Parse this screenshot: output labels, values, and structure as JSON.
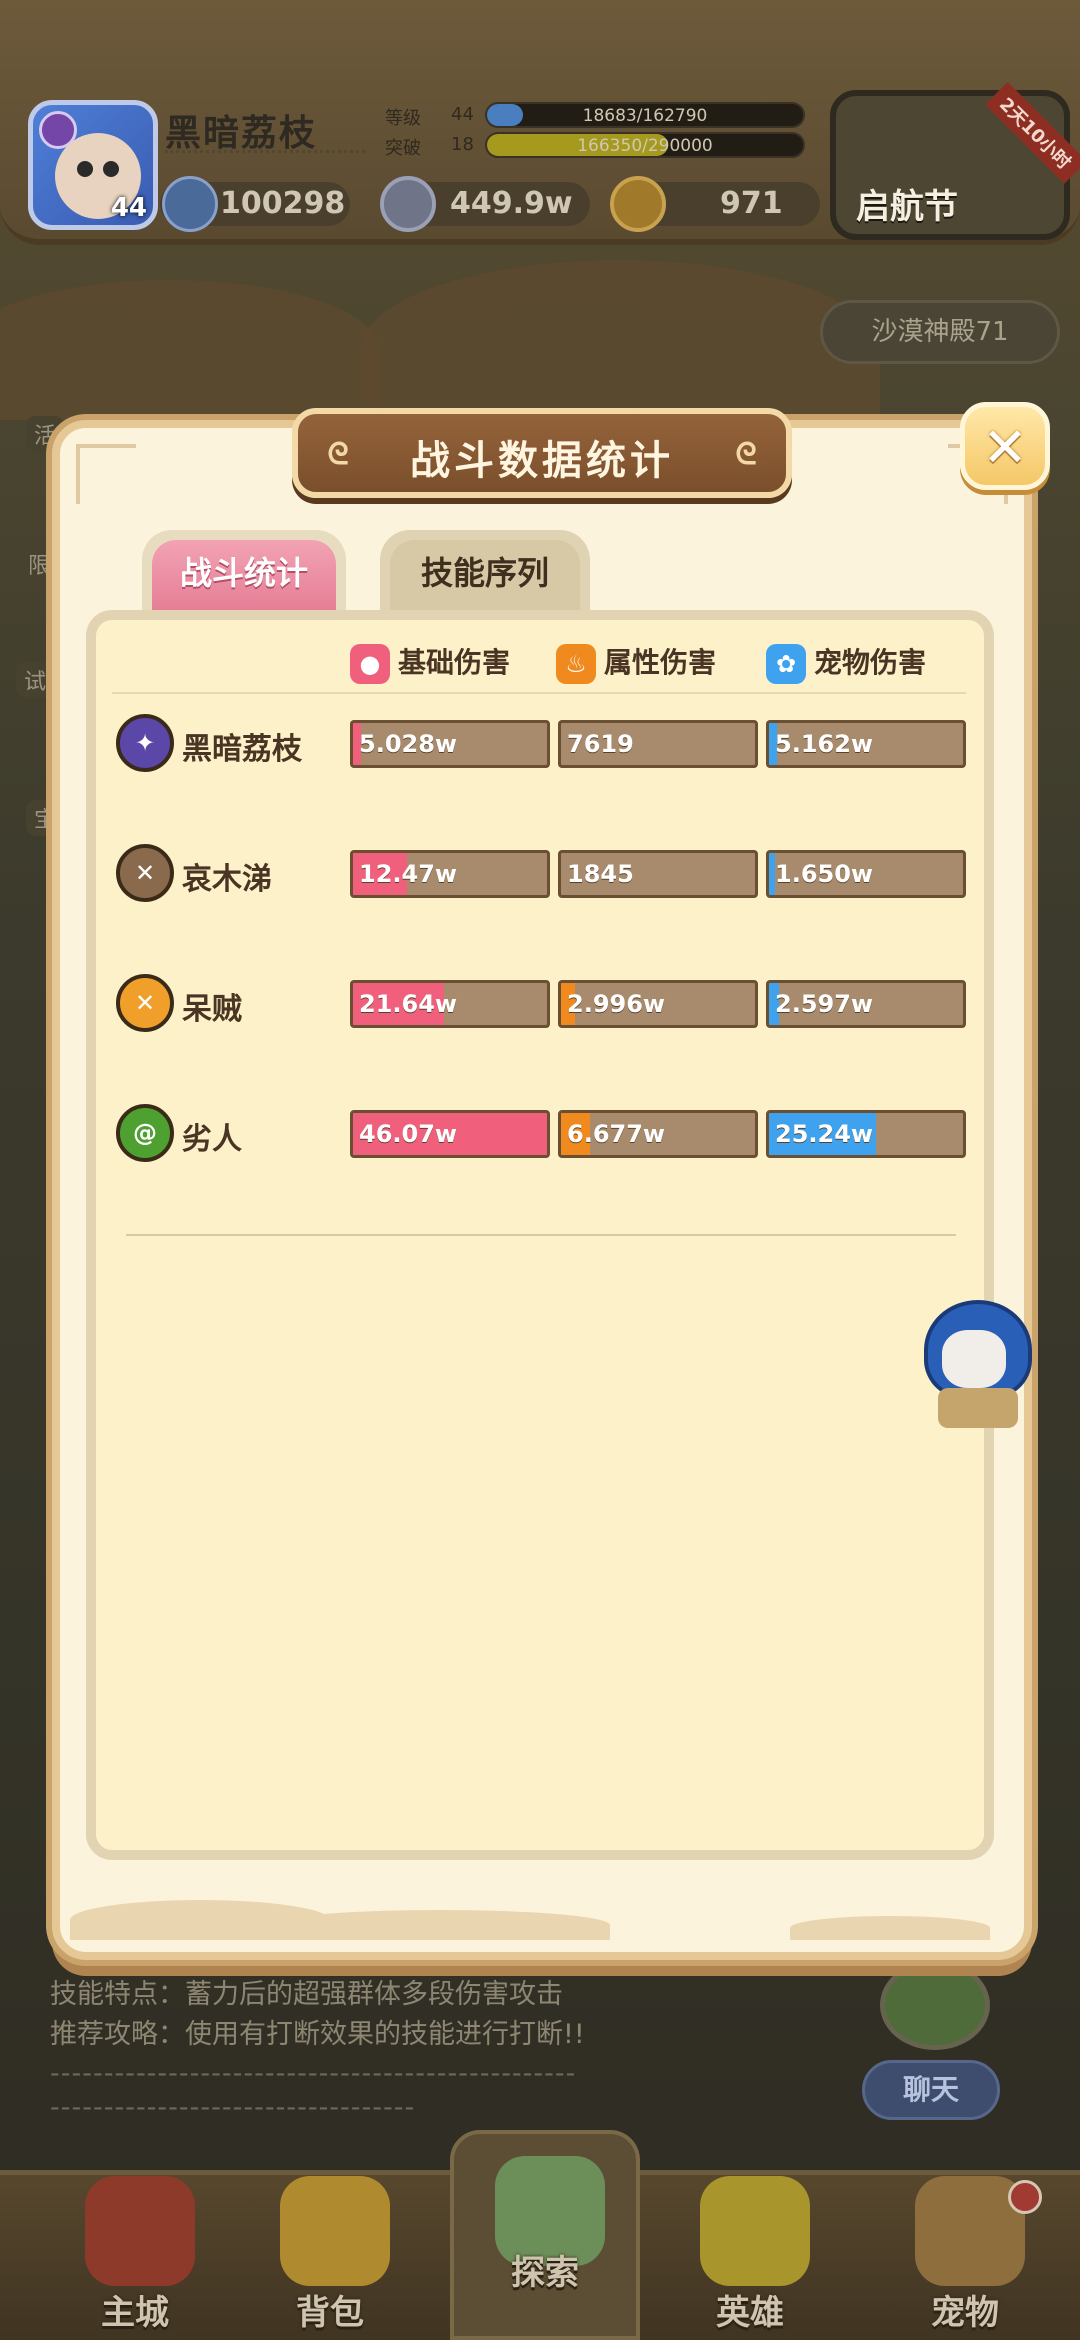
{
  "player": {
    "name": "黑暗荔枝",
    "avatar_level": "44",
    "power": "100298",
    "silver": "449.9w",
    "gold": "971",
    "level_label": "等级",
    "level": "44",
    "level_progress_text": "18683/162790",
    "level_progress": 0.115,
    "break_label": "突破",
    "break_level": "18",
    "break_progress_text": "166350/290000",
    "break_progress": 0.574
  },
  "event": {
    "label": "启航节",
    "tag": "2天10小时"
  },
  "side": {
    "temple": "沙漠神殿71",
    "chip_1": "活",
    "chip_2": "限",
    "chip_3": "试",
    "chip_4": "宝"
  },
  "modal": {
    "title": "战斗数据统计",
    "close": "✕",
    "tabs": [
      {
        "label": "战斗统计",
        "active": true
      },
      {
        "label": "技能序列",
        "active": false
      }
    ],
    "columns": [
      {
        "label": "基础伤害",
        "icon": "person-icon",
        "color": "#f0607c"
      },
      {
        "label": "属性伤害",
        "icon": "fire-icon",
        "color": "#f08a1e"
      },
      {
        "label": "宠物伤害",
        "icon": "paw-icon",
        "color": "#3ea2ef"
      }
    ],
    "rows": [
      {
        "name": "黑暗荔枝",
        "icon": "shield-crest-icon",
        "icon_color": "#5b47a8",
        "values": [
          "5.028w",
          "7619",
          "5.162w"
        ],
        "fractions": [
          0.04,
          0.0,
          0.04
        ]
      },
      {
        "name": "哀木涕",
        "icon": "crossed-swords-icon",
        "icon_color": "#8a6a4c",
        "values": [
          "12.47w",
          "1845",
          "1.650w"
        ],
        "fractions": [
          0.28,
          0.0,
          0.03
        ]
      },
      {
        "name": "呆贼",
        "icon": "crossed-daggers-icon",
        "icon_color": "#f0a02a",
        "values": [
          "21.64w",
          "2.996w",
          "2.597w"
        ],
        "fractions": [
          0.47,
          0.07,
          0.05
        ]
      },
      {
        "name": "劣人",
        "icon": "spiral-icon",
        "icon_color": "#4ea030",
        "values": [
          "46.07w",
          "6.677w",
          "25.24w"
        ],
        "fractions": [
          1.0,
          0.15,
          0.55
        ]
      }
    ]
  },
  "background_text": {
    "line_1": "技能特点：蓄力后的超强群体多段伤害攻击",
    "line_2": "推荐攻略：使用有打断效果的技能进行打断!!",
    "dash_1": "-------------------------------------------------",
    "dash_2": "----------------------------------"
  },
  "chat": {
    "label": "聊天"
  },
  "nav": [
    {
      "label": "主城",
      "icon": "castle-icon"
    },
    {
      "label": "背包",
      "icon": "backpack-icon"
    },
    {
      "label": "探索",
      "icon": "map-scroll-icon"
    },
    {
      "label": "英雄",
      "icon": "hero-icon"
    },
    {
      "label": "宠物",
      "icon": "pet-nest-icon"
    }
  ],
  "colors": {
    "base_damage": "#f0607c",
    "element_damage": "#f08a1e",
    "pet_damage": "#3ea2ef",
    "bar_empty": "#a78b6c"
  }
}
